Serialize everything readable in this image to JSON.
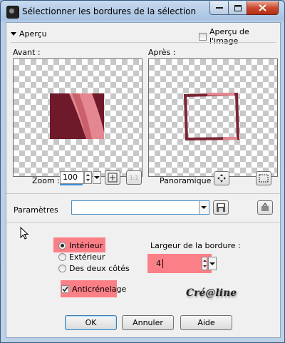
{
  "window": {
    "title": "Sélectionner les bordures de la sélection"
  },
  "preview_section": {
    "toggle_label": "Aperçu",
    "show_image_label": "Aperçu de l'image",
    "show_image_checked": false,
    "before_label": "Avant :",
    "after_label": "Après :"
  },
  "zoom": {
    "label": "Zoom :",
    "value": "100",
    "fit_label": "1:1"
  },
  "pan": {
    "label": "Panoramique :"
  },
  "params": {
    "label": "Paramètres",
    "value": ""
  },
  "options": {
    "inside_label": "Intérieur",
    "outside_label": "Extérieur",
    "both_label": "Des deux côtés",
    "selected": "inside",
    "antialias_label": "Anticrénelage",
    "antialias_checked": true
  },
  "border_width": {
    "label": "Largeur de la bordure :",
    "value": "4"
  },
  "watermark": "Cré@line",
  "buttons": {
    "ok": "OK",
    "cancel": "Annuler",
    "help": "Aide"
  },
  "colors": {
    "highlight": "#fb7f87",
    "image_dark": "#6e1a2a",
    "image_pink": "#e48790",
    "zoom_accent": "#3c8fd8"
  }
}
